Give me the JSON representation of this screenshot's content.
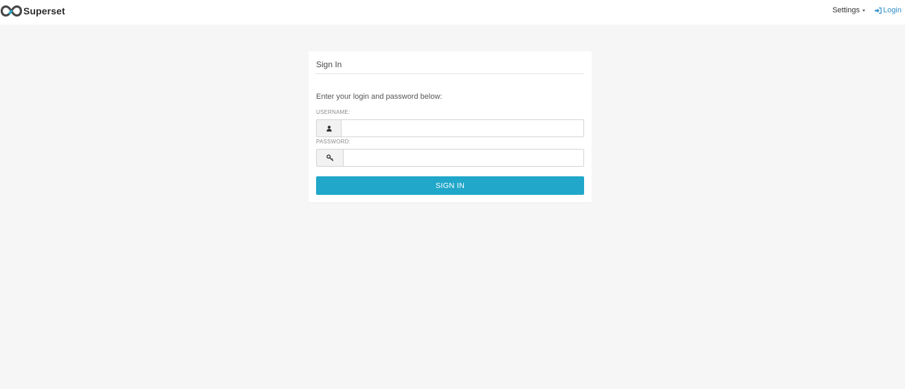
{
  "navbar": {
    "brand_name": "Superset",
    "settings_label": "Settings",
    "login_label": "Login",
    "icons": {
      "brand": "superset-infinity-logo",
      "settings_caret": "caret-down-icon",
      "login": "sign-in-icon"
    }
  },
  "login_form": {
    "title": "Sign In",
    "instructions": "Enter your login and password below:",
    "username": {
      "label": "USERNAME:",
      "value": "",
      "placeholder": "",
      "icon": "user-icon"
    },
    "password": {
      "label": "PASSWORD:",
      "value": "",
      "placeholder": "",
      "icon": "key-icon"
    },
    "submit_label": "SIGN IN"
  },
  "colors": {
    "page_background": "#f6f6f6",
    "navbar_background": "#ffffff",
    "login_link": "#2f8fc9",
    "button_primary": "#20a7c9",
    "logo_dark": "#484848",
    "logo_accent": "#20a7c9"
  }
}
